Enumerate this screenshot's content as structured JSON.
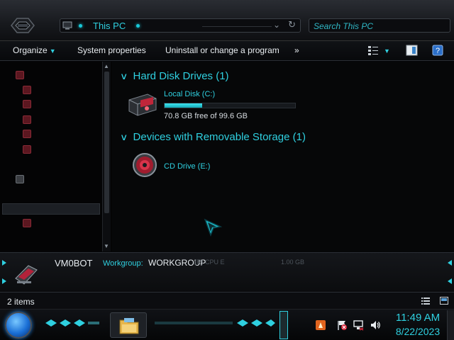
{
  "window": {
    "address": {
      "path": "This PC"
    },
    "search": {
      "placeholder": "Search This PC"
    },
    "toolbar": {
      "organize_label": "Organize",
      "system_properties_label": "System properties",
      "uninstall_label": "Uninstall or change a program",
      "more_label": "»"
    },
    "groups": [
      {
        "title": "Hard Disk Drives (1)",
        "items": [
          {
            "name": "Local Disk (C:)",
            "free_text": "70.8 GB free of 99.6 GB",
            "used_fraction": 0.289
          }
        ]
      },
      {
        "title": "Devices with Removable Storage (1)",
        "items": [
          {
            "name": "CD Drive (E:)"
          }
        ]
      }
    ],
    "details": {
      "computer_name": "VM0BOT",
      "workgroup_label": "Workgroup:",
      "workgroup_value": "WORKGROUP",
      "ghost_processor": "(R) CPU E",
      "ghost_memory": "1.00 GB"
    },
    "status": {
      "item_count": "2 items"
    }
  },
  "taskbar": {
    "clock_time": "11:49 AM",
    "clock_date": "8/22/2023"
  },
  "colors": {
    "accent": "#2fd0e0",
    "background": "#050608",
    "brand_red": "#c0263a"
  },
  "icons": {
    "start": "start-orb-icon",
    "explorer": "file-explorer-icon",
    "volume": "speaker-icon",
    "network": "network-icon",
    "flag": "action-center-flag-icon"
  }
}
